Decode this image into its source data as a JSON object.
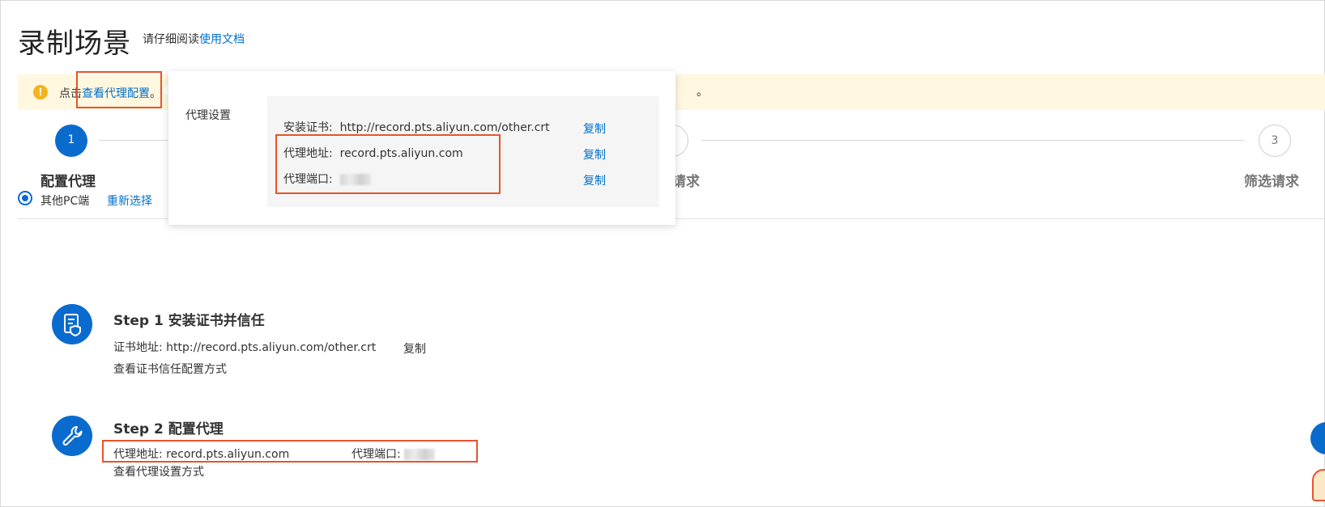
{
  "header": {
    "title": "录制场景",
    "hint_prefix": "请仔细阅读",
    "doc_link": "使用文档"
  },
  "notice": {
    "prefix": "点击",
    "link": "查看代理配置",
    "suffix": "。",
    "tail": "。"
  },
  "steps": [
    {
      "number": "1",
      "title": "配置代理"
    },
    {
      "number": "",
      "title": "请求"
    },
    {
      "number": "3",
      "title": "筛选请求"
    }
  ],
  "radio": {
    "label": "其他PC端",
    "reselect": "重新选择"
  },
  "popover": {
    "label": "代理设置",
    "rows": [
      {
        "label": "安装证书:",
        "value": "http://record.pts.aliyun.com/other.crt",
        "copy": "复制"
      },
      {
        "label": "代理地址:",
        "value": "record.pts.aliyun.com",
        "copy": "复制"
      },
      {
        "label": "代理端口:",
        "value": "",
        "copy": "复制"
      }
    ]
  },
  "section1": {
    "title": "Step 1 安装证书并信任",
    "cert_label": "证书地址:",
    "cert_value": "http://record.pts.aliyun.com/other.crt",
    "copy": "复制",
    "link": "查看证书信任配置方式"
  },
  "section2": {
    "title": "Step 2 配置代理",
    "addr_label": "代理地址:",
    "addr_value": "record.pts.aliyun.com",
    "port_label": "代理端口:",
    "link": "查看代理设置方式"
  },
  "icons": {
    "notice": "warning-icon",
    "section1": "certificate-shield-icon",
    "section2": "wrench-icon"
  },
  "colors": {
    "primary": "#0a6bcf",
    "link": "#0070cc",
    "highlight": "#e8532d",
    "notice_bg": "#fff7e0"
  }
}
